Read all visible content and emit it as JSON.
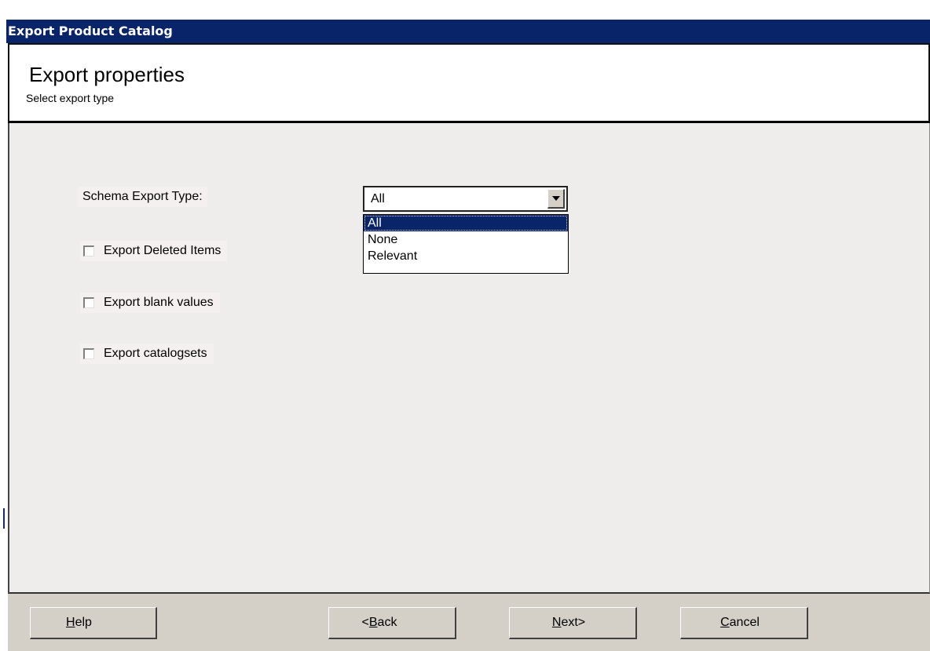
{
  "window": {
    "title": "Export Product Catalog"
  },
  "header": {
    "title": "Export properties",
    "subtitle": "Select export type"
  },
  "form": {
    "schema_label": "Schema Export Type:",
    "schema_value": "All",
    "schema_options": [
      "All",
      "None",
      "Relevant"
    ],
    "checkboxes": [
      {
        "label": "Export Deleted Items",
        "checked": false
      },
      {
        "label": "Export blank values",
        "checked": false
      },
      {
        "label": "Export catalogsets",
        "checked": false
      }
    ]
  },
  "buttons": {
    "help": {
      "accel": "H",
      "rest": "elp"
    },
    "back": {
      "prefix": "<",
      "accel": "B",
      "rest": "ack"
    },
    "next": {
      "accel": "N",
      "rest": "ext>"
    },
    "cancel": {
      "accel": "C",
      "rest": "ancel"
    }
  },
  "colors": {
    "titlebar": "#0a246a",
    "panel": "#eeedeb",
    "button_face": "#d4d0c8"
  }
}
